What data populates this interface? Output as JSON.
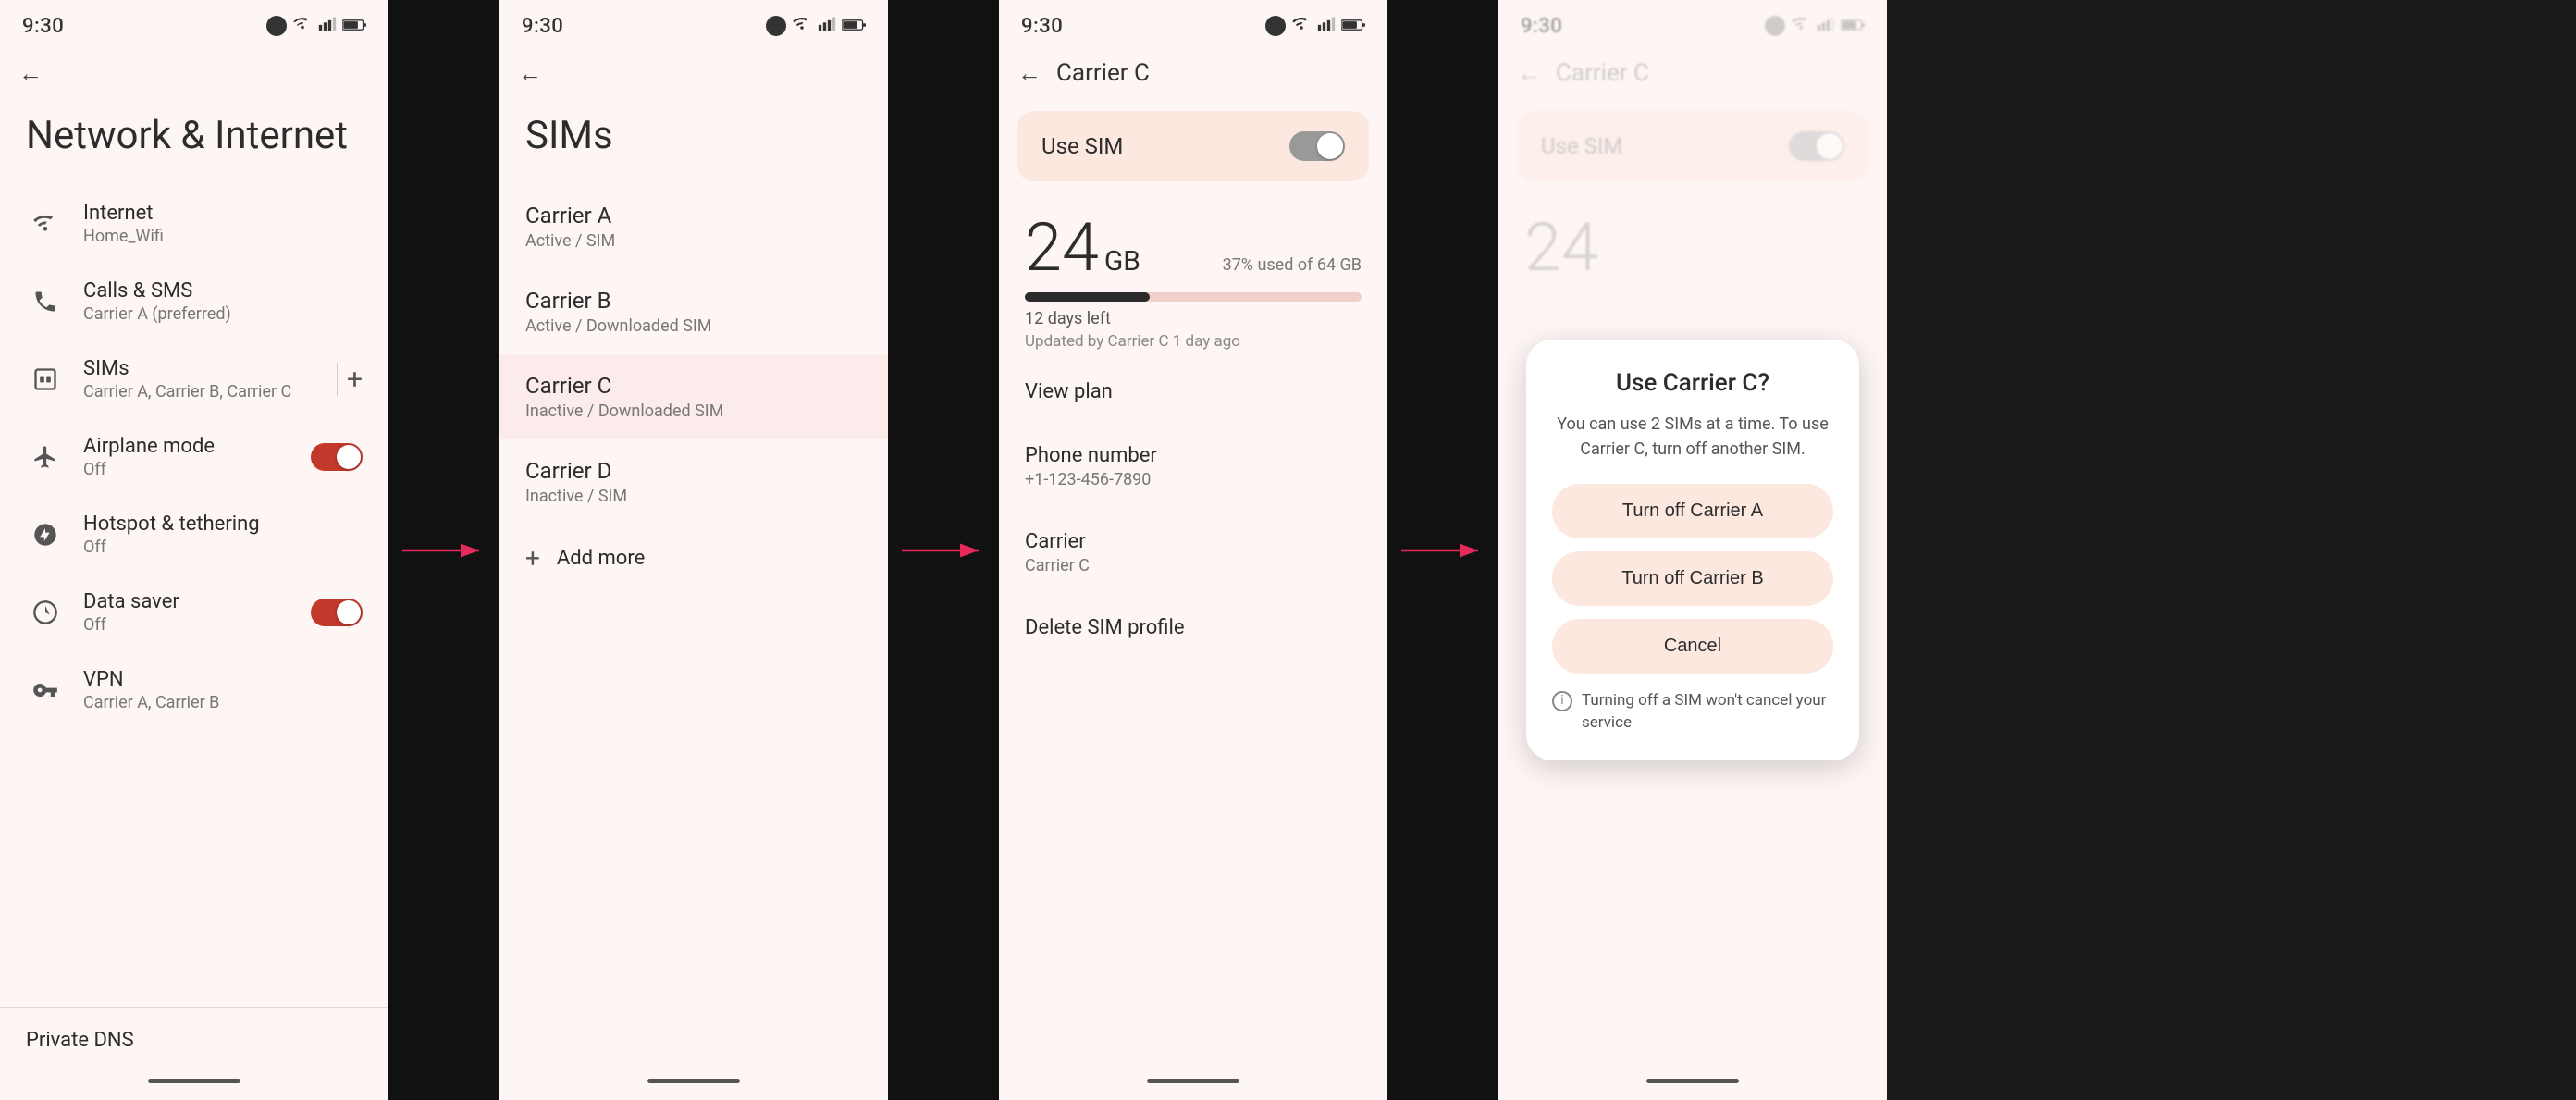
{
  "screen1": {
    "time": "9:30",
    "title": "Network & Internet",
    "menuItems": [
      {
        "id": "internet",
        "label": "Internet",
        "sub": "Home_Wifi",
        "icon": "wifi"
      },
      {
        "id": "calls",
        "label": "Calls & SMS",
        "sub": "Carrier A (preferred)",
        "icon": "phone"
      },
      {
        "id": "sims",
        "label": "SIMs",
        "sub": "Carrier A, Carrier B, Carrier C",
        "icon": "sim",
        "hasAdd": true
      },
      {
        "id": "airplane",
        "label": "Airplane mode",
        "sub": "Off",
        "icon": "airplane",
        "hasToggle": true,
        "toggleOn": true
      },
      {
        "id": "hotspot",
        "label": "Hotspot & tethering",
        "sub": "Off",
        "icon": "hotspot"
      },
      {
        "id": "datasaver",
        "label": "Data saver",
        "sub": "Off",
        "icon": "datasaver",
        "hasToggle": true,
        "toggleOn": true
      },
      {
        "id": "vpn",
        "label": "VPN",
        "sub": "Carrier A, Carrier B",
        "icon": "vpn"
      }
    ],
    "privateDns": "Private DNS"
  },
  "screen2": {
    "time": "9:30",
    "title": "SIMs",
    "carriers": [
      {
        "name": "Carrier A",
        "status": "Active / SIM"
      },
      {
        "name": "Carrier B",
        "status": "Active / Downloaded SIM"
      },
      {
        "name": "Carrier C",
        "status": "Inactive / Downloaded SIM",
        "highlighted": true
      },
      {
        "name": "Carrier D",
        "status": "Inactive / SIM"
      }
    ],
    "addMore": "Add more"
  },
  "screen3": {
    "time": "9:30",
    "backLabel": "Carrier C",
    "useSim": "Use SIM",
    "dataAmount": "24",
    "dataUnit": "GB",
    "dataPercent": "37% used of 64 GB",
    "daysLeft": "12 days left",
    "updatedBy": "Updated by Carrier C 1 day ago",
    "viewPlan": "View plan",
    "phoneNumber": "Phone number",
    "phoneNumberValue": "+1-123-456-7890",
    "carrier": "Carrier",
    "carrierValue": "Carrier C",
    "deleteProfile": "Delete SIM profile"
  },
  "screen4": {
    "time": "9:30",
    "backLabel": "Carrier C",
    "useSim": "Use SIM",
    "dataAmount": "24",
    "dialog": {
      "title": "Use Carrier C?",
      "description": "You can use 2 SIMs at a time. To use Carrier C, turn off another SIM.",
      "btn1": "Turn off Carrier A",
      "btn2": "Turn off Carrier B",
      "btn3": "Cancel",
      "note": "Turning off a SIM won't cancel your service"
    }
  }
}
